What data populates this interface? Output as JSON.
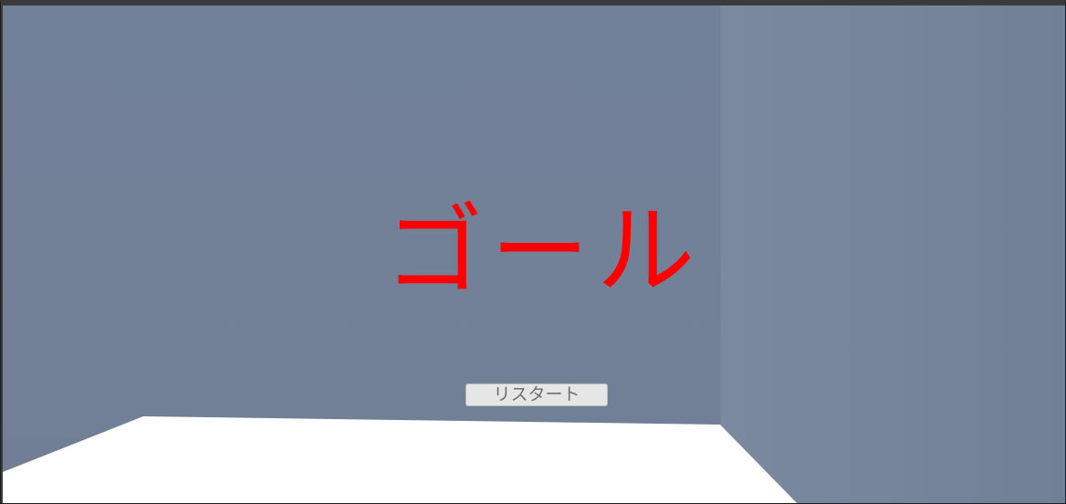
{
  "game": {
    "goal_text": "ゴール",
    "restart_label": "リスタート"
  },
  "colors": {
    "back_wall": "#73829a",
    "side_wall": "#76849c",
    "floor": "#ffffff",
    "goal_text": "#ff0000",
    "button_bg": "#e6e6e6",
    "button_text": "#6e6e6e"
  }
}
